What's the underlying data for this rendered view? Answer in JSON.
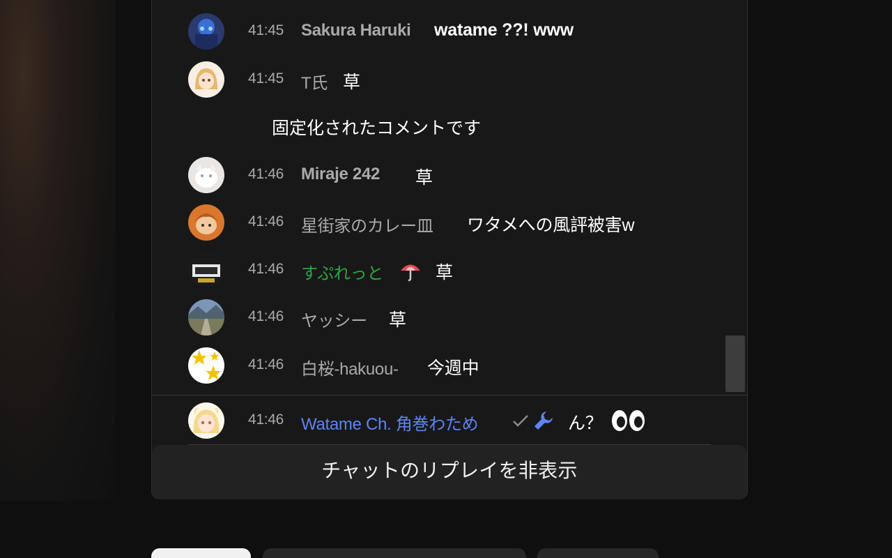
{
  "chat": {
    "pinned_note": "固定化されたコメントです",
    "messages": [
      {
        "time": "41:45",
        "author": "Sakura Haruki",
        "text": "watame ??! www"
      },
      {
        "time": "41:45",
        "author": "T氏",
        "text": "草"
      },
      {
        "time": "41:46",
        "author": "Miraje 242",
        "text": "草"
      },
      {
        "time": "41:46",
        "author": "星街家のカレー皿",
        "text": "ワタメへの風評被害w"
      },
      {
        "time": "41:46",
        "author": "すぷれっと",
        "text": "草"
      },
      {
        "time": "41:46",
        "author": "ヤッシー",
        "text": "草"
      },
      {
        "time": "41:46",
        "author": "白桜-hakuou-",
        "text": "今週中"
      },
      {
        "time": "41:46",
        "author": "Watame Ch. 角巻わため",
        "text": "ん？"
      }
    ],
    "member_author_color": "#2ba640",
    "owner_author_color": "#5e84f1"
  },
  "controls": {
    "hide_replay_label": "チャットのリプレイを非表示"
  }
}
